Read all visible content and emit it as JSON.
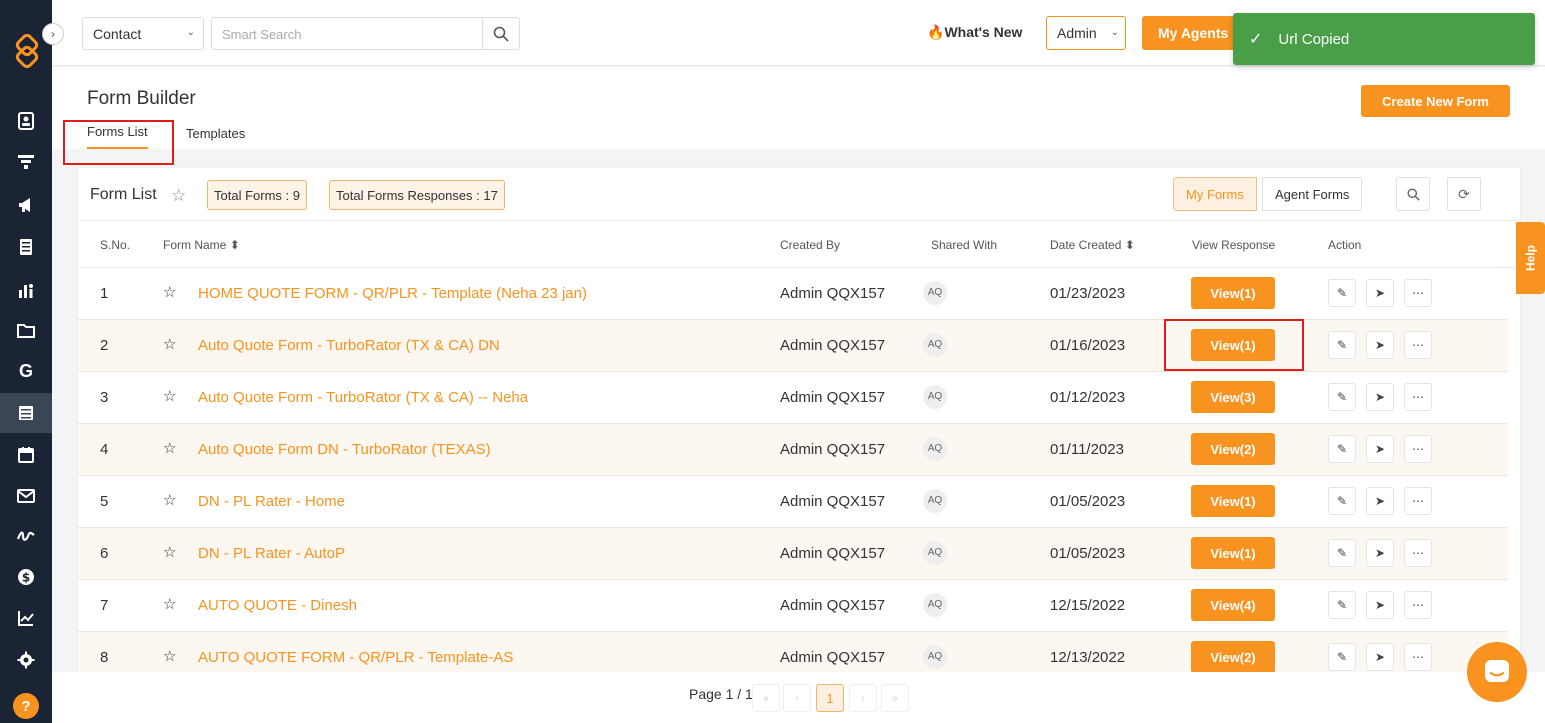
{
  "topbar": {
    "contact_select": "Contact",
    "search_placeholder": "Smart Search",
    "whats_new": "What's New",
    "admin_select": "Admin",
    "my_agents": "My Agents"
  },
  "toast": {
    "message": "Url Copied"
  },
  "page": {
    "title": "Form Builder",
    "tabs": [
      "Forms List",
      "Templates"
    ],
    "create_button": "Create New Form"
  },
  "panel": {
    "title": "Form List",
    "total_forms": "Total Forms : 9",
    "total_responses": "Total Forms Responses : 17",
    "filter_my": "My Forms",
    "filter_agent": "Agent Forms"
  },
  "table": {
    "headers": {
      "sno": "S.No.",
      "name": "Form Name",
      "created_by": "Created By",
      "shared_with": "Shared With",
      "date_created": "Date Created",
      "view_response": "View Response",
      "action": "Action"
    },
    "rows": [
      {
        "sno": "1",
        "name": "HOME QUOTE FORM - QR/PLR - Template (Neha 23 jan)",
        "by": "Admin QQX157",
        "shared": "AQ",
        "date": "01/23/2023",
        "view": "View(1)"
      },
      {
        "sno": "2",
        "name": "Auto Quote Form - TurboRator (TX & CA) DN",
        "by": "Admin QQX157",
        "shared": "AQ",
        "date": "01/16/2023",
        "view": "View(1)"
      },
      {
        "sno": "3",
        "name": "Auto Quote Form - TurboRator (TX & CA) -- Neha",
        "by": "Admin QQX157",
        "shared": "AQ",
        "date": "01/12/2023",
        "view": "View(3)"
      },
      {
        "sno": "4",
        "name": "Auto Quote Form DN - TurboRator (TEXAS)",
        "by": "Admin QQX157",
        "shared": "AQ",
        "date": "01/11/2023",
        "view": "View(2)"
      },
      {
        "sno": "5",
        "name": "DN - PL Rater - Home",
        "by": "Admin QQX157",
        "shared": "AQ",
        "date": "01/05/2023",
        "view": "View(1)"
      },
      {
        "sno": "6",
        "name": "DN - PL Rater - AutoP",
        "by": "Admin QQX157",
        "shared": "AQ",
        "date": "01/05/2023",
        "view": "View(1)"
      },
      {
        "sno": "7",
        "name": "AUTO QUOTE - Dinesh",
        "by": "Admin QQX157",
        "shared": "AQ",
        "date": "12/15/2022",
        "view": "View(4)"
      },
      {
        "sno": "8",
        "name": "AUTO QUOTE FORM - QR/PLR - Template-AS",
        "by": "Admin QQX157",
        "shared": "AQ",
        "date": "12/13/2022",
        "view": "View(2)"
      }
    ]
  },
  "pager": {
    "label": "Page 1 / 1",
    "current": "1"
  },
  "help_tab": "Help",
  "colors": {
    "accent": "#f7931e",
    "sidebar": "#1b2434",
    "toast": "#4b9e48",
    "highlight": "#e21b1b"
  }
}
